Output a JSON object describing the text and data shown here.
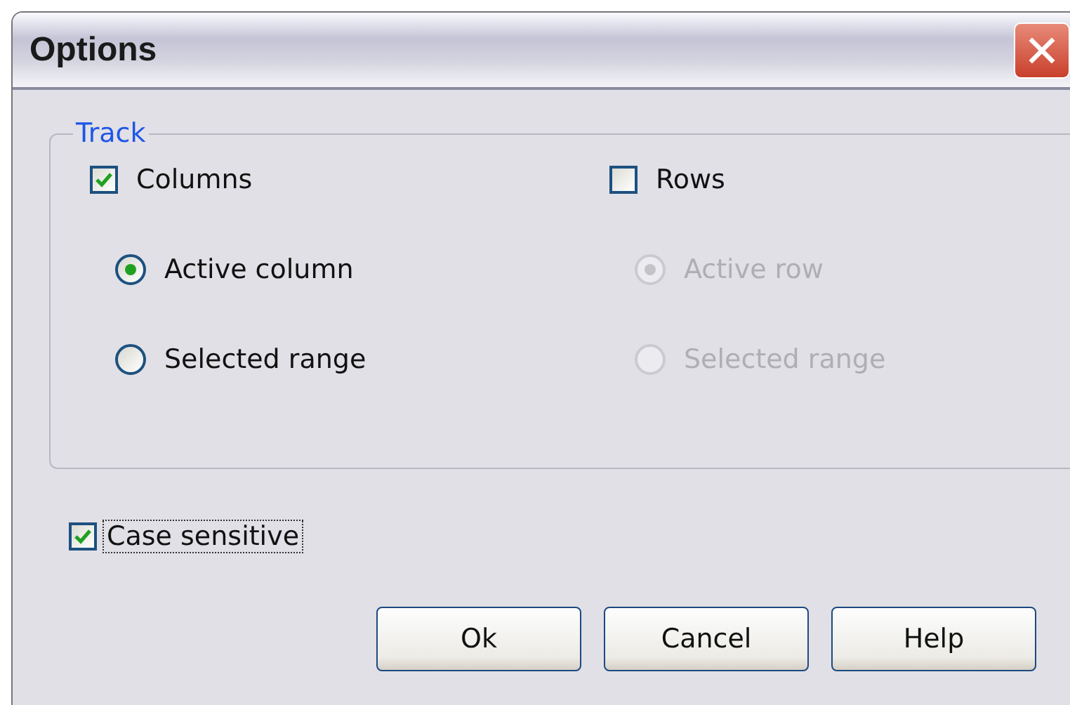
{
  "window": {
    "title": "Options"
  },
  "track": {
    "label": "Track",
    "columns": [
      {
        "checkbox": {
          "label": "Columns",
          "checked": true
        },
        "disabled": false,
        "radios": [
          {
            "label": "Active column",
            "selected": true
          },
          {
            "label": "Selected range",
            "selected": false
          }
        ]
      },
      {
        "checkbox": {
          "label": "Rows",
          "checked": false
        },
        "disabled": true,
        "radios": [
          {
            "label": "Active row",
            "selected": true
          },
          {
            "label": "Selected range",
            "selected": false
          }
        ]
      }
    ]
  },
  "case_sensitive": {
    "label": "Case sensitive",
    "checked": true,
    "focused": true
  },
  "buttons": [
    "Ok",
    "Cancel",
    "Help"
  ]
}
